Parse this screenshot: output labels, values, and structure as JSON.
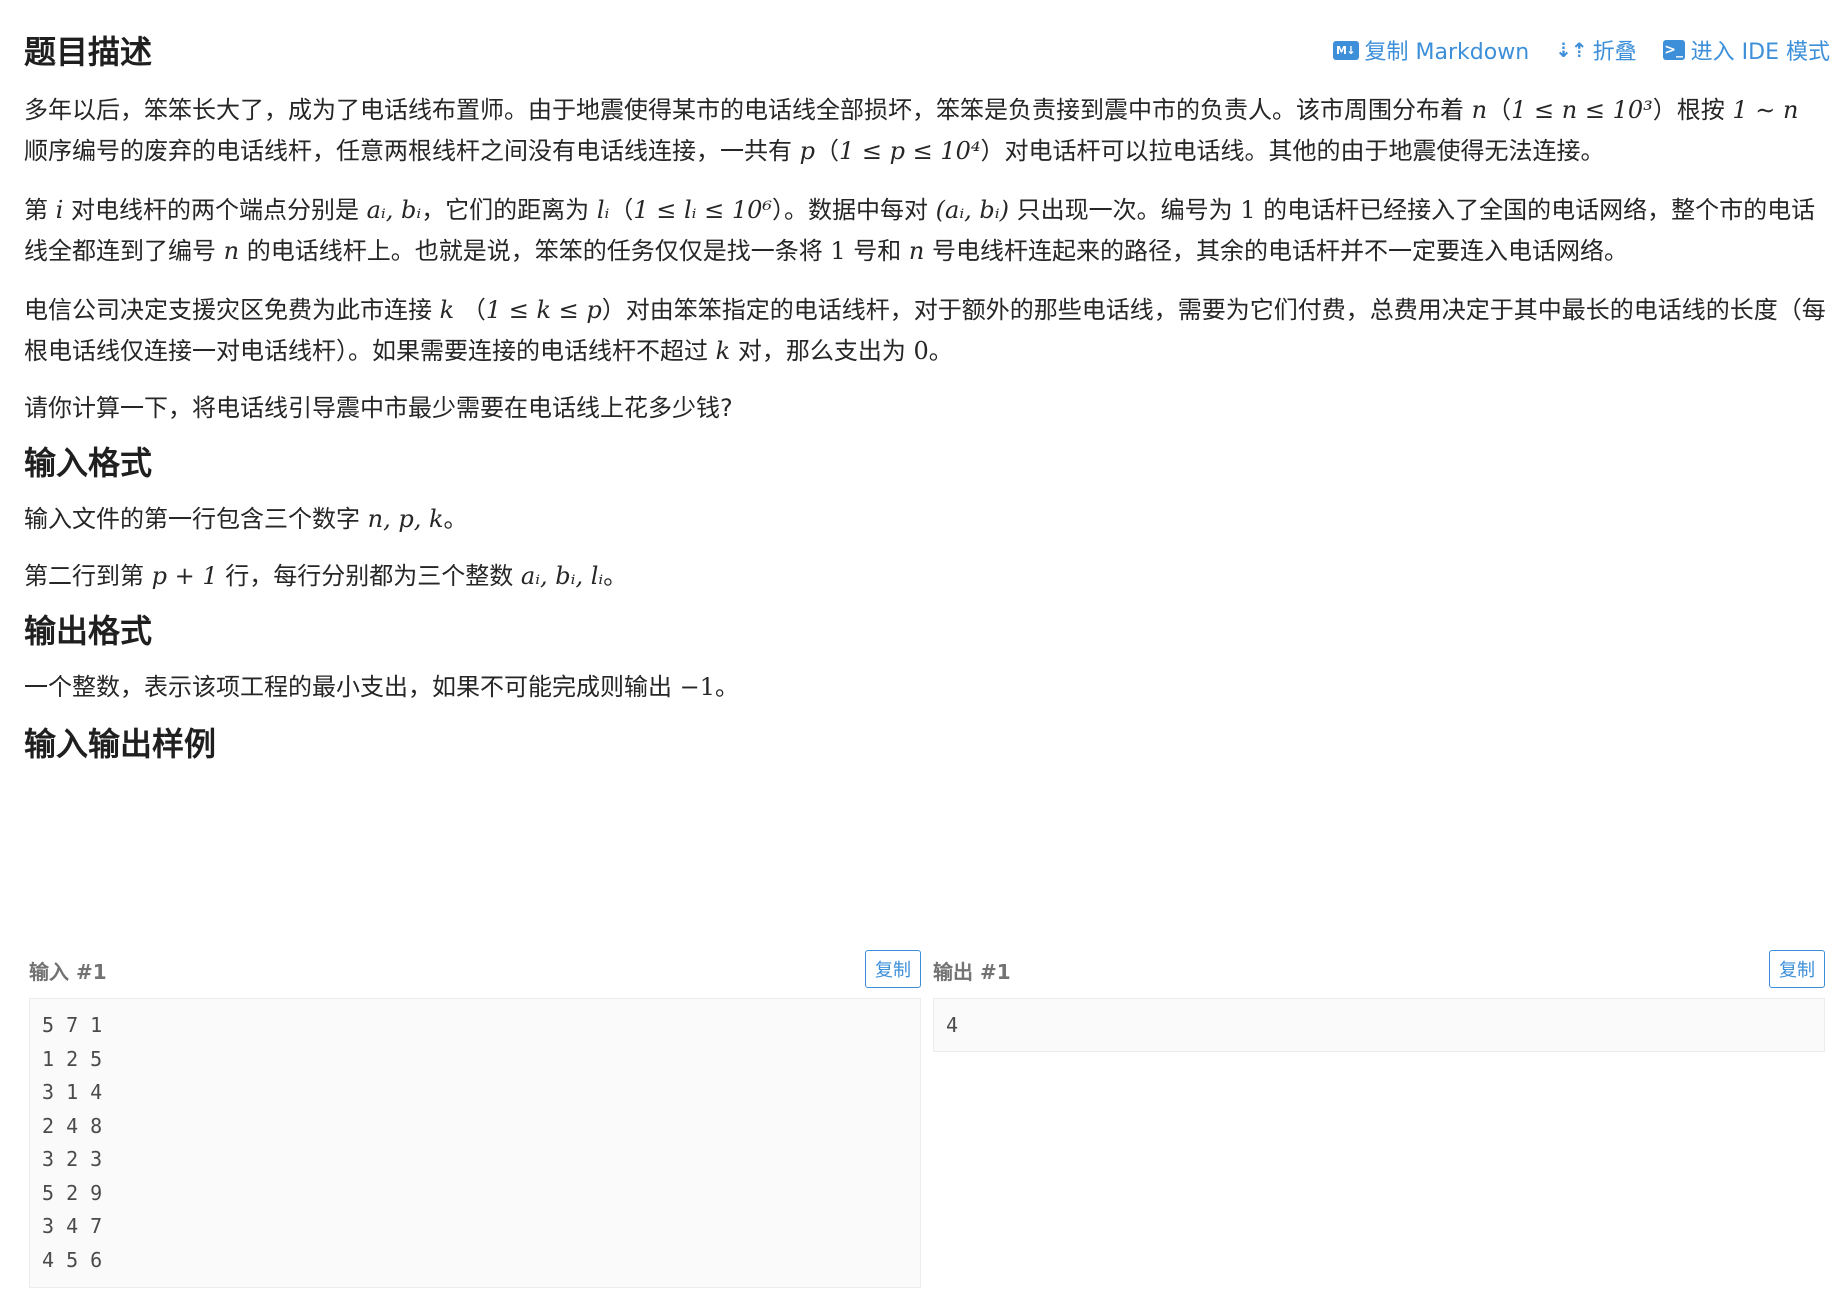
{
  "toolbar": {
    "copy_markdown": "复制 Markdown",
    "fold": "折叠",
    "ide_mode": "进入 IDE 模式",
    "md_icon_text": "M↓"
  },
  "sections": {
    "description": "题目描述",
    "input_format": "输入格式",
    "output_format": "输出格式",
    "samples": "输入输出样例"
  },
  "description": {
    "p1": {
      "a": "多年以后，笨笨长大了，成为了电话线布置师。由于地震使得某市的电话线全部损坏，笨笨是负责接到震中市的负责人。该市周围分布着 ",
      "m1": "n",
      "b": "（",
      "m2": "1 ≤ n ≤ 10³",
      "c": "）根按 ",
      "m3": "1 ∼ n",
      "d": " 顺序编号的废弃的电话线杆，任意两根线杆之间没有电话线连接，一共有 ",
      "m4": "p",
      "e": "（",
      "m5": "1 ≤ p ≤ 10⁴",
      "f": "）对电话杆可以拉电话线。其他的由于地震使得无法连接。"
    },
    "p2": {
      "a": "第 ",
      "m1": "i",
      "b": " 对电线杆的两个端点分别是 ",
      "m2": "aᵢ, bᵢ",
      "c": "，它们的距离为 ",
      "m3": "lᵢ",
      "d": "（",
      "m4": "1 ≤ lᵢ ≤ 10⁶",
      "e": "）。数据中每对 ",
      "m5": "(aᵢ, bᵢ)",
      "f": " 只出现一次。编号为 ",
      "m6": "1",
      "g": " 的电话杆已经接入了全国的电话网络，整个市的电话线全都连到了编号 ",
      "m7": "n",
      "h": " 的电话线杆上。也就是说，笨笨的任务仅仅是找一条将 ",
      "m8": "1",
      "i": " 号和 ",
      "m9": "n",
      "j": " 号电线杆连起来的路径，其余的电话杆并不一定要连入电话网络。"
    },
    "p3": {
      "a": "电信公司决定支援灾区免费为此市连接 ",
      "m1": "k",
      "b": " （",
      "m2": "1 ≤ k ≤ p",
      "c": "）对由笨笨指定的电话线杆，对于额外的那些电话线，需要为它们付费，总费用决定于其中最长的电话线的长度（每根电话线仅连接一对电话线杆）。如果需要连接的电话线杆不超过 ",
      "m3": "k",
      "d": " 对，那么支出为 ",
      "m4": "0",
      "e": "。"
    },
    "p4": "请你计算一下，将电话线引导震中市最少需要在电话线上花多少钱?"
  },
  "input_format": {
    "p1": {
      "a": "输入文件的第一行包含三个数字 ",
      "m1": "n, p, k",
      "b": "。"
    },
    "p2": {
      "a": "第二行到第 ",
      "m1": "p + 1",
      "b": " 行，每行分别都为三个整数 ",
      "m2": "aᵢ, bᵢ, lᵢ",
      "c": "。"
    }
  },
  "output_format": {
    "p1": {
      "a": "一个整数，表示该项工程的最小支出，如果不可能完成则输出 ",
      "m1": "−1",
      "b": "。"
    }
  },
  "samples": {
    "input_title": "输入 #1",
    "output_title": "输出 #1",
    "copy_label": "复制",
    "input_lines": [
      "5 7 1",
      "1 2 5",
      "3 1 4",
      "2 4 8",
      "3 2 3",
      "5 2 9",
      "3 4 7",
      "4 5 6"
    ],
    "output_lines": [
      "4"
    ]
  }
}
